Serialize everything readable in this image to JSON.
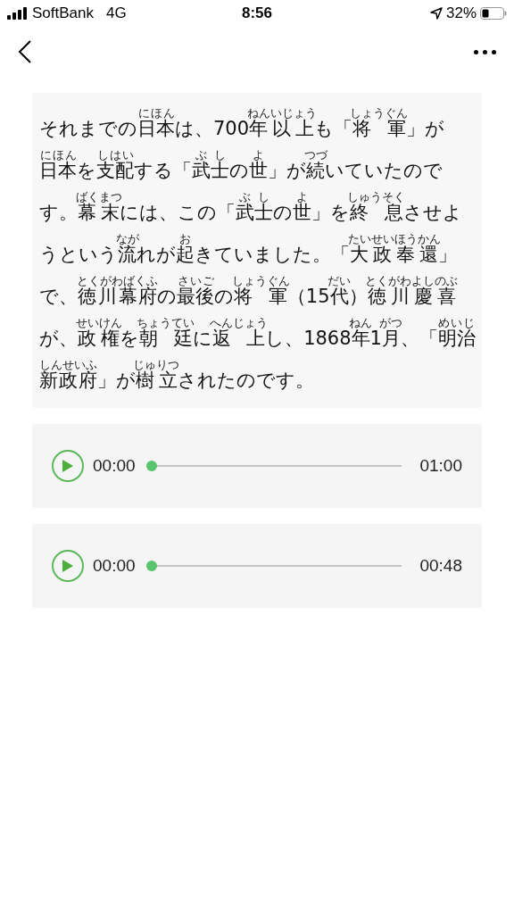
{
  "status_bar": {
    "carrier": "SoftBank",
    "network": "4G",
    "time": "8:56",
    "battery": "32%"
  },
  "passage": {
    "lines": [
      [
        {
          "text": "それまでの"
        },
        {
          "text": "日本",
          "ruby": "にほん"
        },
        {
          "text": "は、700"
        },
        {
          "text": "年以上",
          "ruby": "ねんいじょう"
        },
        {
          "text": "も「"
        },
        {
          "text": "将 軍",
          "ruby": "しょうぐん"
        },
        {
          "text": "」が"
        }
      ],
      [
        {
          "text": "日本",
          "ruby": "にほん"
        },
        {
          "text": "を"
        },
        {
          "text": "支配",
          "ruby": "しはい"
        },
        {
          "text": "する「"
        },
        {
          "text": "武士",
          "ruby": "ぶし"
        },
        {
          "text": "の"
        },
        {
          "text": "世",
          "ruby": "よ"
        },
        {
          "text": "」が"
        },
        {
          "text": "続",
          "ruby": "つづ"
        },
        {
          "text": "いていたので"
        }
      ],
      [
        {
          "text": "す。"
        },
        {
          "text": "幕末",
          "ruby": "ばくまつ"
        },
        {
          "text": "には、この「"
        },
        {
          "text": "武士",
          "ruby": "ぶし"
        },
        {
          "text": "の"
        },
        {
          "text": "世",
          "ruby": "よ"
        },
        {
          "text": "」を"
        },
        {
          "text": "終 息",
          "ruby": "しゅうそく"
        },
        {
          "text": "させよ"
        }
      ],
      [
        {
          "text": "うという"
        },
        {
          "text": "流",
          "ruby": "なが"
        },
        {
          "text": "れが"
        },
        {
          "text": "起",
          "ruby": "お"
        },
        {
          "text": "きていました。「"
        },
        {
          "text": "大政奉還",
          "ruby": "たいせいほうかん"
        },
        {
          "text": "」"
        }
      ],
      [
        {
          "text": "で、"
        },
        {
          "text": "徳川幕府",
          "ruby": "とくがわばくふ"
        },
        {
          "text": "の"
        },
        {
          "text": "最後",
          "ruby": "さいご"
        },
        {
          "text": "の"
        },
        {
          "text": "将 軍",
          "ruby": "しょうぐん"
        },
        {
          "text": "（15"
        },
        {
          "text": "代",
          "ruby": "だい"
        },
        {
          "text": "）"
        },
        {
          "text": "徳川慶喜",
          "ruby": "とくがわよしのぶ"
        }
      ],
      [
        {
          "text": "が、"
        },
        {
          "text": "政権",
          "ruby": "せいけん"
        },
        {
          "text": "を"
        },
        {
          "text": "朝 廷",
          "ruby": "ちょうてい"
        },
        {
          "text": "に"
        },
        {
          "text": "返 上",
          "ruby": "へんじょう"
        },
        {
          "text": "し、1868"
        },
        {
          "text": "年",
          "ruby": "ねん"
        },
        {
          "text": "1"
        },
        {
          "text": "月",
          "ruby": "がつ"
        },
        {
          "text": "、「"
        },
        {
          "text": "明治",
          "ruby": "めいじ"
        }
      ],
      [
        {
          "text": "新政府",
          "ruby": "しんせいふ"
        },
        {
          "text": "」が"
        },
        {
          "text": "樹立",
          "ruby": "じゅりつ"
        },
        {
          "text": "されたのです。"
        }
      ]
    ]
  },
  "players": [
    {
      "current": "00:00",
      "duration": "01:00",
      "level": 0
    },
    {
      "current": "00:00",
      "duration": "00:48",
      "level": 0
    }
  ]
}
